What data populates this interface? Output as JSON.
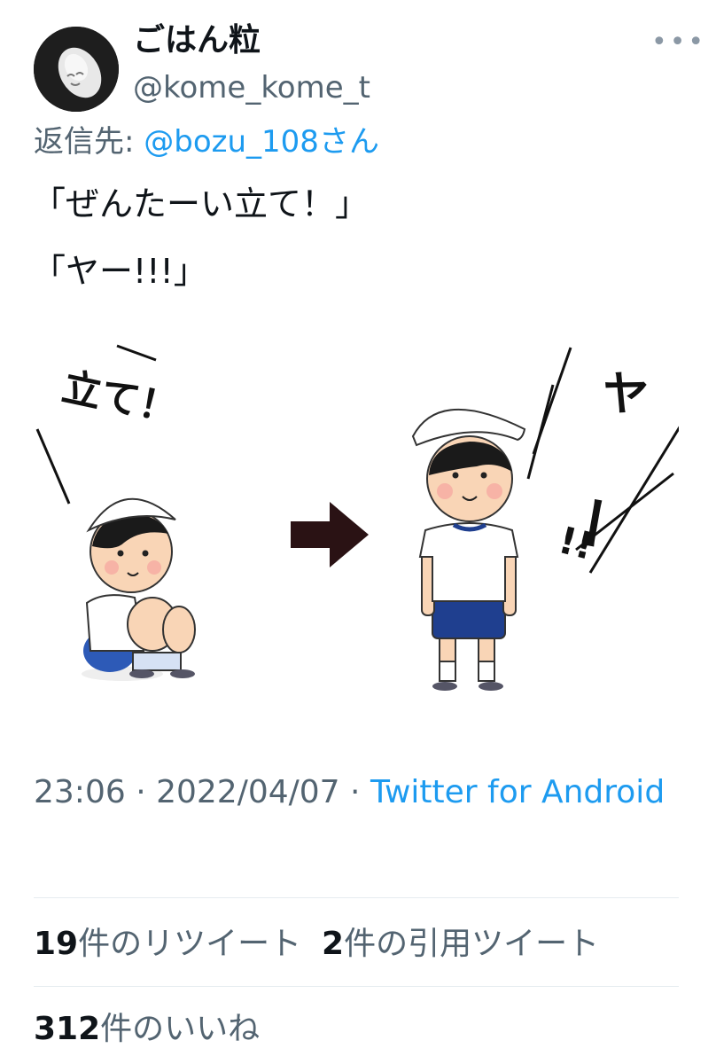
{
  "header": {
    "display_name": "ごはん粒",
    "handle": "@kome_kome_t",
    "more_icon": "•••"
  },
  "reply": {
    "prefix": "返信先: ",
    "mention": "@bozu_108さん"
  },
  "tweet": {
    "line1": "「ぜんたーい立て！」",
    "line2": "「ヤー!!!」"
  },
  "media": {
    "left_caption": "立て！",
    "right_caption_1": "ヤ",
    "right_caption_2": "ー",
    "right_caption_3": "!!",
    "arrow_icon": "right-arrow-icon"
  },
  "meta": {
    "time": "23:06",
    "sep1": " · ",
    "date": "2022/04/07",
    "sep2": " · ",
    "source": "Twitter for Android"
  },
  "stats": {
    "retweets_count": "19",
    "retweets_label": "件のリツイート",
    "quotes_count": "2",
    "quotes_label": "件の引用ツイート",
    "likes_count": "312",
    "likes_label": "件のいいね"
  },
  "colors": {
    "link": "#1d9bf0",
    "secondary": "#536471",
    "text": "#0f1419"
  }
}
